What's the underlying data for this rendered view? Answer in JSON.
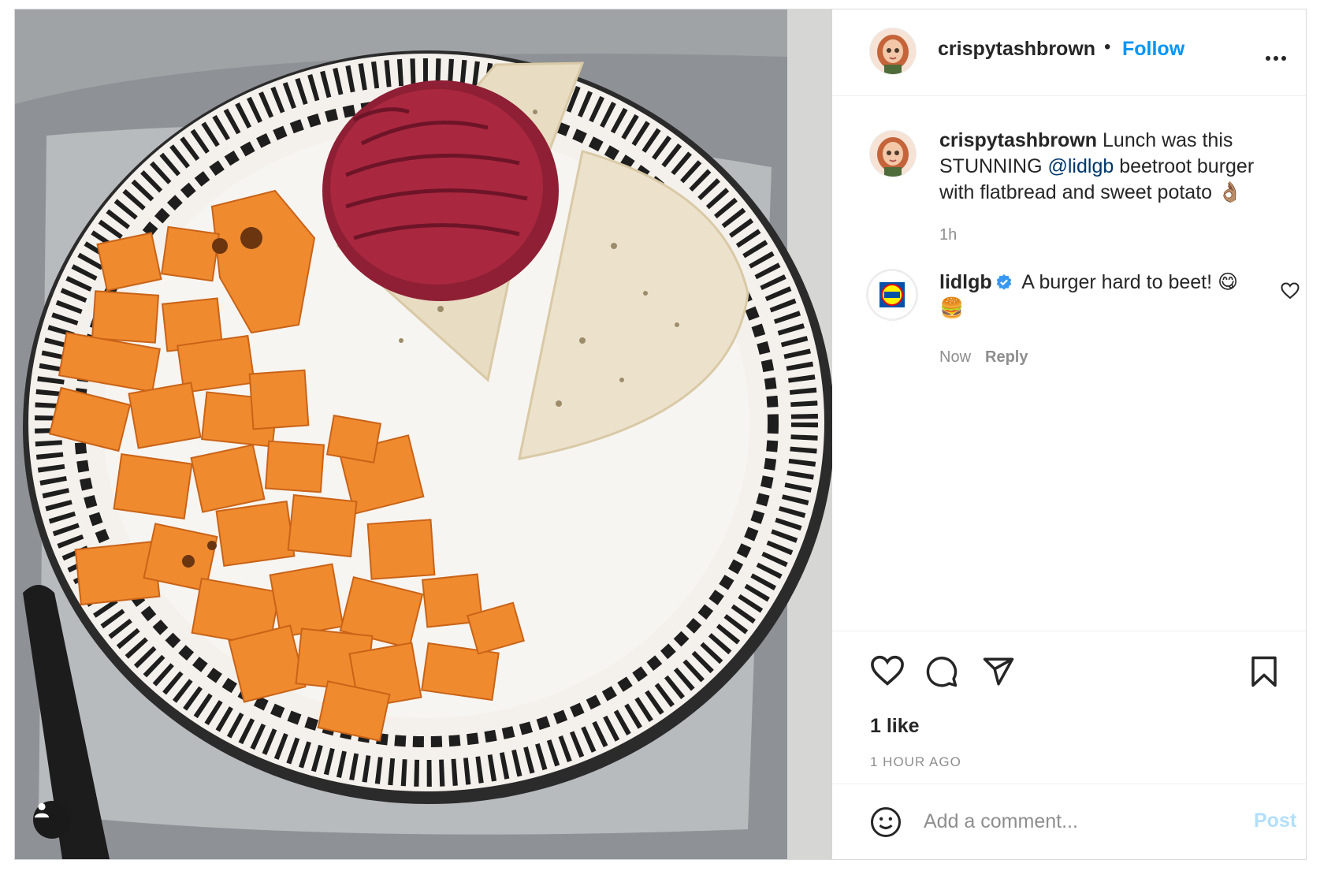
{
  "post": {
    "author": "crispytashbrown",
    "follow_label": "Follow",
    "separator": "•",
    "caption": {
      "username": "crispytashbrown",
      "text_before": " Lunch was this STUNNING ",
      "mention": "@lidlgb",
      "text_after": " beetroot burger with flatbread and sweet potato 👌🏽",
      "time": "1h"
    },
    "comments": [
      {
        "username": "lidlgb",
        "verified": true,
        "text": " A burger hard to beet! 😋🍔",
        "time": "Now",
        "reply_label": "Reply"
      }
    ],
    "likes": "1 like",
    "timestamp": "1 HOUR AGO",
    "composer": {
      "placeholder": "Add a comment...",
      "post_label": "Post"
    }
  },
  "icons": {
    "more": "more-options-icon",
    "like": "heart-icon",
    "comment": "comment-icon",
    "share": "paper-plane-icon",
    "save": "bookmark-icon",
    "emoji": "emoji-smile-icon",
    "tag": "user-tag-icon"
  },
  "colors": {
    "accent": "#0095f6",
    "post_disabled": "#b2dffc",
    "muted": "#8e8e8e",
    "text": "#262626",
    "verified": "#3897f0"
  }
}
